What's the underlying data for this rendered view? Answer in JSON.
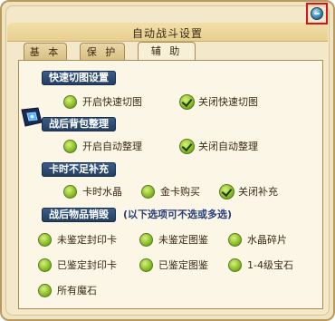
{
  "window": {
    "title": "自动战斗设置"
  },
  "tabs": [
    {
      "label": "基 本",
      "active": false
    },
    {
      "label": "保 护",
      "active": false
    },
    {
      "label": "辅 助",
      "active": true
    }
  ],
  "sections": {
    "quick_map": {
      "label": "快速切图设置",
      "options": [
        {
          "label": "开启快速切图",
          "checked": false
        },
        {
          "label": "关闭快速切图",
          "checked": true
        }
      ]
    },
    "bag_sort": {
      "label": "战后背包整理",
      "options": [
        {
          "label": "开启自动整理",
          "checked": false
        },
        {
          "label": "关闭自动整理",
          "checked": true
        }
      ]
    },
    "card_refill": {
      "label": "卡时不足补充",
      "options": [
        {
          "label": "卡时水晶",
          "checked": false
        },
        {
          "label": "金卡购买",
          "checked": false
        },
        {
          "label": "关闭补充",
          "checked": true
        }
      ]
    },
    "destroy_items": {
      "label": "战后物品销毁",
      "note": "(以下选项可不选或多选)",
      "options": [
        {
          "label": "未鉴定封印卡",
          "checked": false
        },
        {
          "label": "未鉴定图鉴",
          "checked": false
        },
        {
          "label": "水晶碎片",
          "checked": false
        },
        {
          "label": "已鉴定封印卡",
          "checked": false
        },
        {
          "label": "已鉴定图鉴",
          "checked": false
        },
        {
          "label": "1-4级宝石",
          "checked": false
        },
        {
          "label": "所有魔石",
          "checked": false
        }
      ]
    }
  },
  "colors": {
    "section_bg": "#2d4a72",
    "radio_green": "#8cbf2b",
    "highlight": "#e0101a"
  }
}
